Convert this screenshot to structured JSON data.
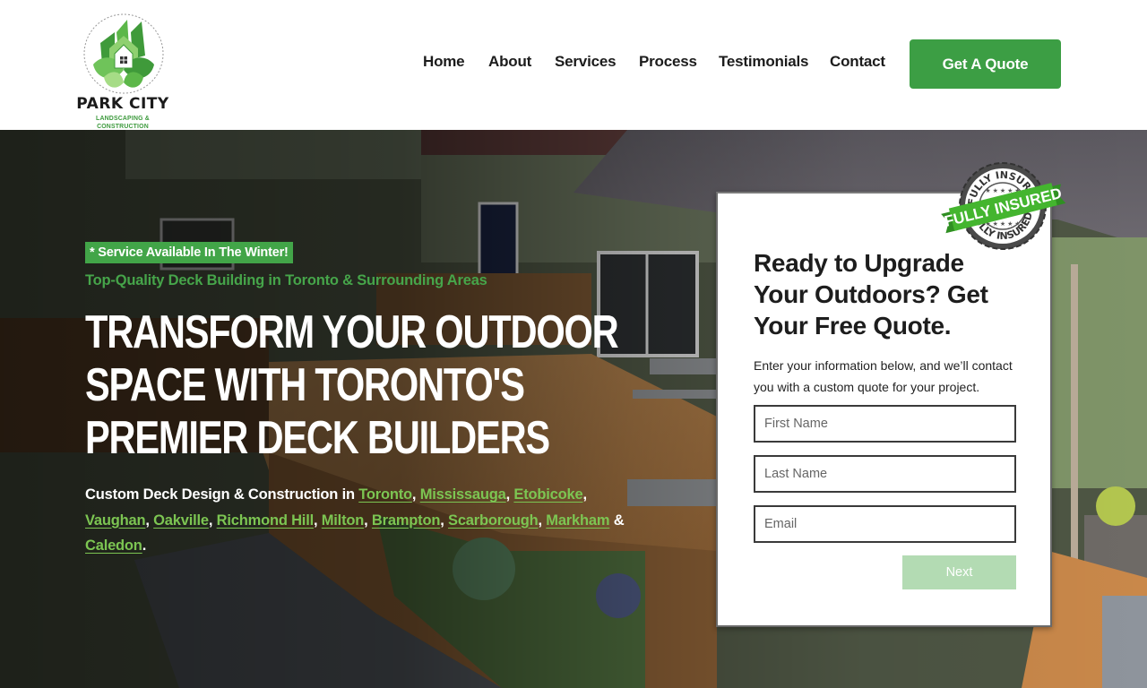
{
  "brand": {
    "name": "PARK CITY",
    "subtitle": "LANDSCAPING & CONSTRUCTION",
    "colors": {
      "primary_green": "#3c9e44",
      "link_green": "#7cc552",
      "tagline_green": "#46a54a",
      "light_green": "#b3dbb3"
    }
  },
  "nav": {
    "items": [
      {
        "label": "Home"
      },
      {
        "label": "About"
      },
      {
        "label": "Services"
      },
      {
        "label": "Process"
      },
      {
        "label": "Testimonials"
      },
      {
        "label": "Contact"
      }
    ],
    "cta_label": "Get A Quote"
  },
  "hero": {
    "badge": "* Service Available In The Winter!",
    "tagline": "Top-Quality Deck Building in Toronto & Surrounding Areas",
    "headline": "TRANSFORM YOUR OUTDOOR SPACE WITH TORONTO'S PREMIER DECK BUILDERS",
    "cities_intro": "Custom Deck Design & Construction in ",
    "cities": [
      "Toronto",
      "Mississauga",
      "Etobicoke",
      "Vaughan",
      "Oakville",
      "Richmond Hill",
      "Milton",
      "Brampton",
      "Scarborough",
      "Markham",
      "Caledon"
    ],
    "cities_conjunction": " & ",
    "cities_end": "."
  },
  "quote_form": {
    "title": "Ready to Upgrade Your Outdoors? Get Your Free Quote.",
    "description": "Enter your information below, and we’ll contact you with a custom quote for your project.",
    "fields": [
      {
        "name": "first_name",
        "placeholder": "First Name",
        "value": ""
      },
      {
        "name": "last_name",
        "placeholder": "Last Name",
        "value": ""
      },
      {
        "name": "email",
        "placeholder": "Email",
        "value": ""
      }
    ],
    "next_label": "Next"
  },
  "insured_badge": {
    "ribbon_text": "FULLY INSURED",
    "ring_text": "FULLY INSURED"
  }
}
